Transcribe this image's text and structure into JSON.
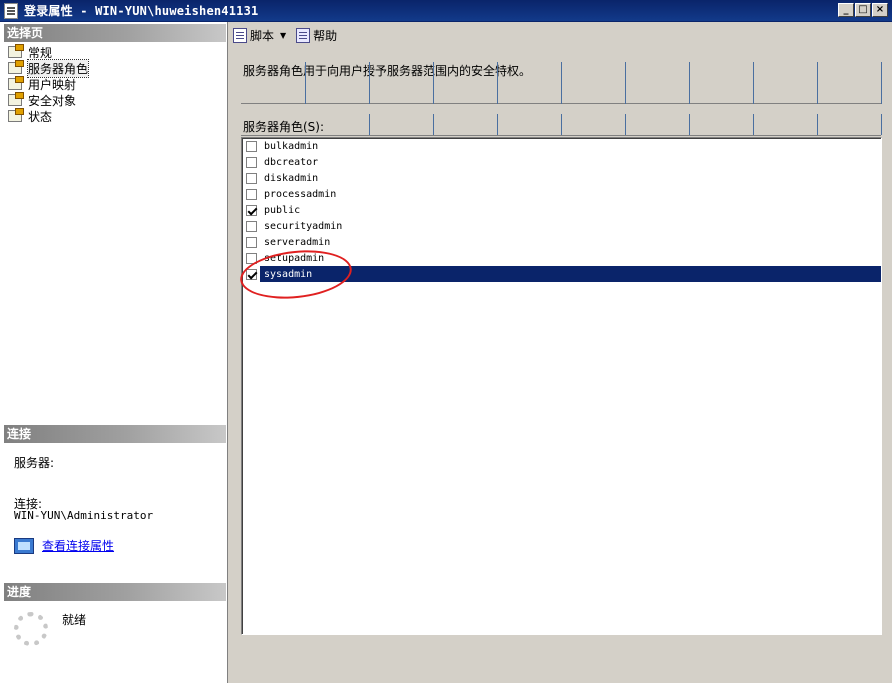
{
  "window": {
    "title": "登录属性 - WIN-YUN\\huweishen41131",
    "minimize_glyph": "_",
    "maximize_glyph": "□",
    "close_glyph": "×"
  },
  "left": {
    "pages_header": "选择页",
    "pages": [
      {
        "label": "常规",
        "selected": false
      },
      {
        "label": "服务器角色",
        "selected": true
      },
      {
        "label": "用户映射",
        "selected": false
      },
      {
        "label": "安全对象",
        "selected": false
      },
      {
        "label": "状态",
        "selected": false
      }
    ],
    "connection_header": "连接",
    "server_label": "服务器:",
    "connection_label": "连接:",
    "connection_value": "WIN-YUN\\Administrator",
    "view_conn_props": "查看连接属性",
    "progress_header": "进度",
    "status_text": "就绪"
  },
  "toolbar": {
    "script_label": "脚本",
    "help_label": "帮助"
  },
  "main": {
    "description": "服务器角色用于向用户授予服务器范围内的安全特权。",
    "roles_label": "服务器角色(S):",
    "roles": [
      {
        "name": "bulkadmin",
        "checked": false,
        "selected": false
      },
      {
        "name": "dbcreator",
        "checked": false,
        "selected": false
      },
      {
        "name": "diskadmin",
        "checked": false,
        "selected": false
      },
      {
        "name": "processadmin",
        "checked": false,
        "selected": false
      },
      {
        "name": "public",
        "checked": true,
        "selected": false
      },
      {
        "name": "securityadmin",
        "checked": false,
        "selected": false
      },
      {
        "name": "serveradmin",
        "checked": false,
        "selected": false
      },
      {
        "name": "setupadmin",
        "checked": false,
        "selected": false
      },
      {
        "name": "sysadmin",
        "checked": true,
        "selected": true
      }
    ]
  },
  "colors": {
    "selection": "#0a246a",
    "annotation": "#e02020"
  }
}
